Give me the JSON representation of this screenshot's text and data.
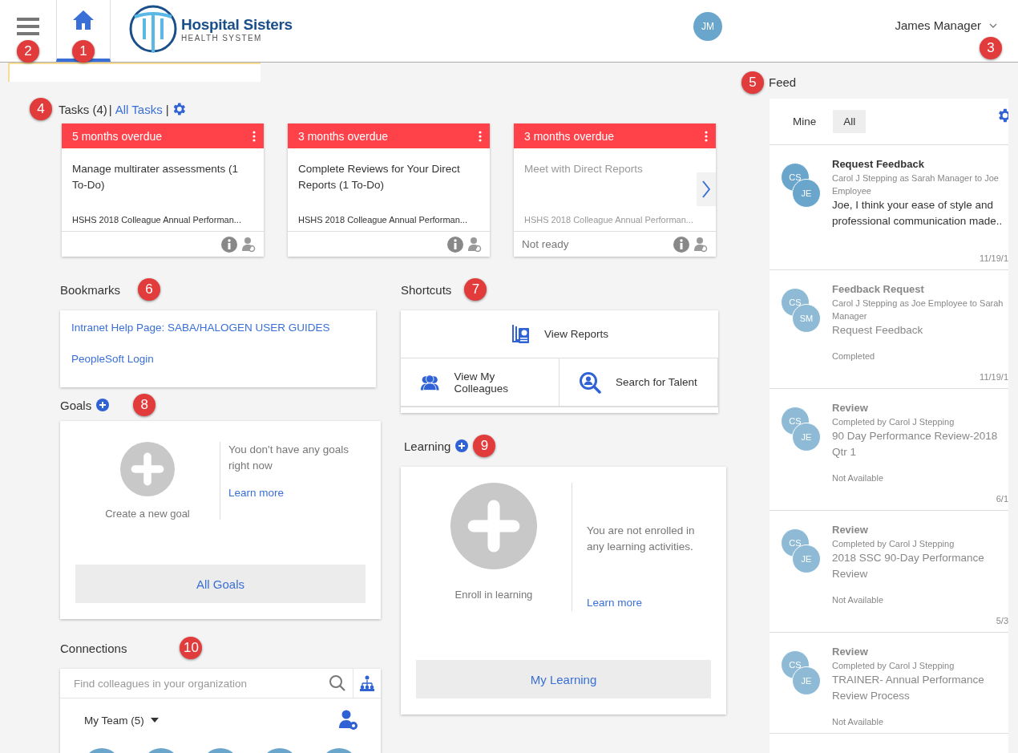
{
  "header": {
    "menu": {
      "marker": "2"
    },
    "home_tab": {
      "selected": true,
      "marker": "1"
    },
    "logo": {
      "name": "Hospital Sisters",
      "tagline": "HEALTH SYSTEM"
    },
    "avatar": "JM",
    "user": {
      "name": "James Manager",
      "marker": "3"
    }
  },
  "tasks": {
    "marker": "4",
    "title": "Tasks (4)",
    "separator": "|",
    "link": "All Tasks",
    "cards": [
      {
        "due": "5 months overdue",
        "title": "Manage multirater assessments (1 To-Do)",
        "program": "HSHS 2018 Colleague Annual Performan...",
        "disabled": false
      },
      {
        "due": "3 months overdue",
        "title": "Complete Reviews for Your Direct Reports (1 To-Do)",
        "program": "HSHS 2018 Colleague Annual Performan...",
        "disabled": false
      },
      {
        "due": "3 months overdue",
        "title": "Meet with Direct Reports",
        "program": "HSHS 2018 Colleague Annual Performan...",
        "status": "Not ready",
        "disabled": true
      }
    ]
  },
  "bookmarks": {
    "marker": "6",
    "title": "Bookmarks",
    "links": [
      "Intranet Help Page: SABA/HALOGEN USER GUIDES",
      "PeopleSoft Login"
    ]
  },
  "shortcuts": {
    "marker": "7",
    "title": "Shortcuts",
    "items": [
      {
        "label": "View Reports",
        "kind": "reports",
        "wide": true
      },
      {
        "label": "View My Colleagues",
        "kind": "colleagues",
        "wide": false
      },
      {
        "label": "Search for Talent",
        "kind": "talent",
        "wide": false
      }
    ]
  },
  "goals": {
    "marker": "8",
    "title": "Goals",
    "create": "Create a new goal",
    "message": "You don't have any goals right now",
    "learn_more": "Learn more",
    "button": "All Goals"
  },
  "learning": {
    "marker": "9",
    "title": "Learning",
    "create": "Enroll in learning",
    "message": "You are not enrolled in any learning activities.",
    "learn_more": "Learn more",
    "button": "My Learning"
  },
  "connections": {
    "marker": "10",
    "title": "Connections",
    "search": {
      "placeholder": "Find colleagues in your organization"
    },
    "team": "My Team (5)"
  },
  "feed": {
    "marker": "5",
    "title": "Feed",
    "tabs": [
      {
        "label": "Mine",
        "selected": false
      },
      {
        "label": "All",
        "selected": true
      }
    ],
    "items": [
      {
        "from": "CS",
        "to": "JE",
        "title": "Request Feedback",
        "byline": "Carol J Stepping as Sarah Manager to Joe Employee",
        "message": "Joe, I think your ease of style and professional communication made..",
        "date": "11/19/1",
        "faded": false
      },
      {
        "from": "CS",
        "to": "SM",
        "title": "Feedback Request",
        "byline": "Carol J Stepping as Joe Employee to Sarah Manager",
        "message": "Request Feedback",
        "status": "Completed",
        "date": "11/19/1",
        "faded": true
      },
      {
        "from": "CS",
        "to": "JE",
        "title": "Review",
        "byline": "Completed by Carol J Stepping",
        "message": "90 Day Performance Review-2018 Qtr 1",
        "status": "Not Available",
        "date": "6/1",
        "faded": true
      },
      {
        "from": "CS",
        "to": "JE",
        "title": "Review",
        "byline": "Completed by Carol J Stepping",
        "message": "2018 SSC 90-Day Performance Review",
        "status": "Not Available",
        "date": "5/3",
        "faded": true
      },
      {
        "from": "CS",
        "to": "JE",
        "title": "Review",
        "byline": "Completed by Carol J Stepping",
        "message": "TRAINER- Annual Performance Review Process",
        "status": "Not Available",
        "faded": true
      }
    ]
  }
}
